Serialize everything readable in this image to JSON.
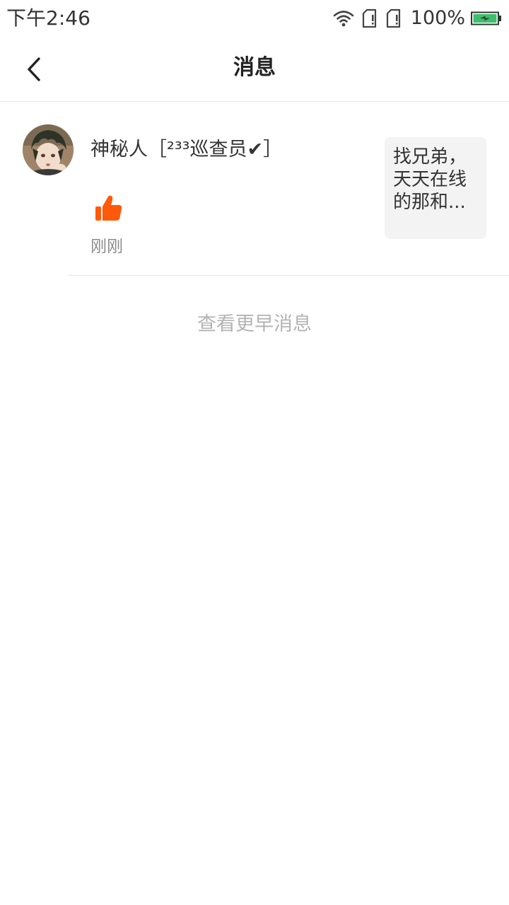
{
  "status_bar": {
    "time": "下午2:46",
    "battery_percent": "100%",
    "battery_level": 1.0,
    "icons": [
      "wifi-icon",
      "sim-card-1-icon",
      "sim-card-2-icon",
      "battery-charging-icon"
    ],
    "battery_color": "#3cbf6a"
  },
  "header": {
    "title": "消息",
    "back_icon": "chevron-left-icon"
  },
  "notifications": [
    {
      "username": "神秘人［²³³巡查员✔］",
      "action_icon": "thumbs-up-icon",
      "action_color": "#ff5a0a",
      "time": "刚刚",
      "preview": "找兄弟，天天在线的那和..."
    }
  ],
  "more_link": "查看更早消息"
}
